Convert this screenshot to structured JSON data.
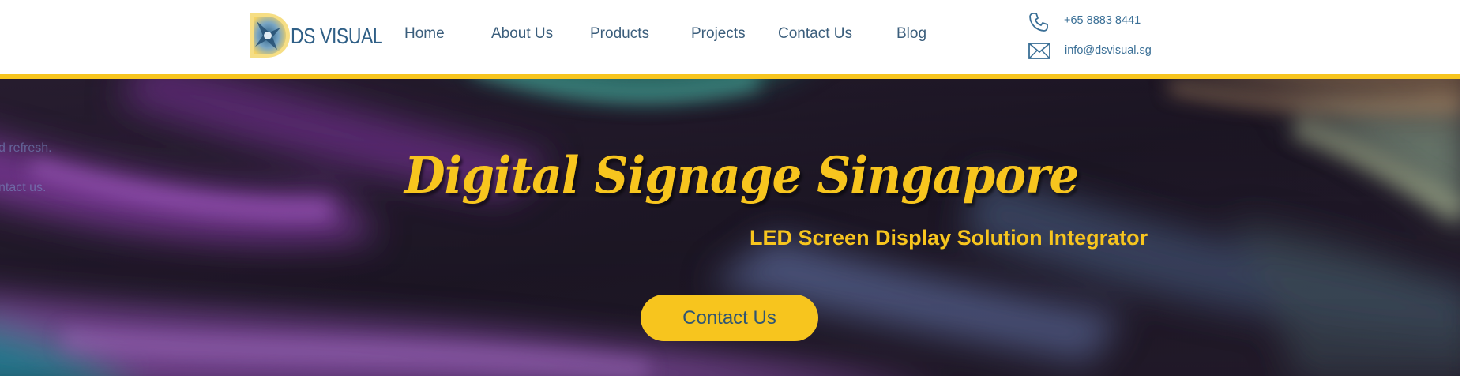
{
  "brand": {
    "name": "DS VISUAL",
    "logo_icon": "ds-visual-logo-mark",
    "colors": {
      "primary": "#2f5f86",
      "accent": "#f7c51e",
      "nav_text": "#3b5e7c"
    }
  },
  "nav": {
    "items": [
      {
        "label": "Home"
      },
      {
        "label": "About Us"
      },
      {
        "label": "Products"
      },
      {
        "label": "Projects"
      },
      {
        "label": "Contact Us"
      },
      {
        "label": "Blog"
      }
    ]
  },
  "contact": {
    "phone": {
      "icon": "phone-icon",
      "text": "+65 8883 8441"
    },
    "email": {
      "icon": "envelope-icon",
      "text": "info@dsvisual.sg"
    }
  },
  "hero": {
    "ghost_lines": [
      "d refresh.",
      "ntact us."
    ],
    "title": "Digital Signage Singapore",
    "subtitle": "LED Screen Display Solution Integrator",
    "button_label": "Contact Us"
  }
}
